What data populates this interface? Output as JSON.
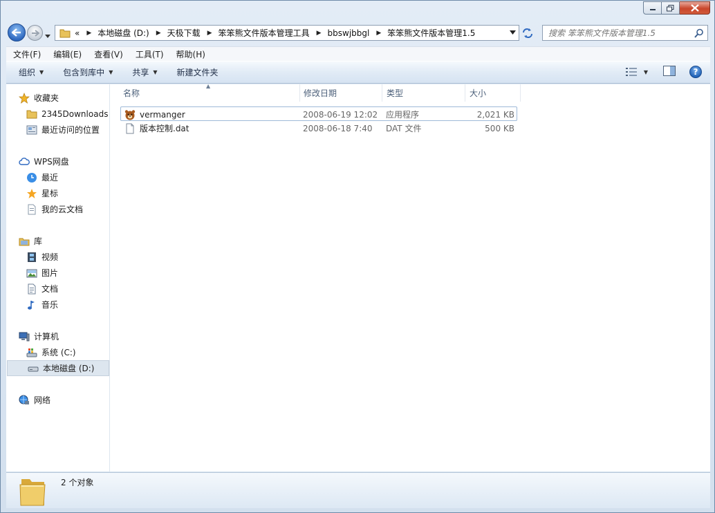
{
  "window": {
    "caption_buttons": [
      "minimize",
      "maximize",
      "close"
    ]
  },
  "address": {
    "overflow": "«",
    "crumbs": [
      "本地磁盘 (D:)",
      "天极下载",
      "笨笨熊文件版本管理工具",
      "bbswjbbgl",
      "笨笨熊文件版本管理1.5"
    ]
  },
  "search": {
    "placeholder": "搜索 笨笨熊文件版本管理1.5"
  },
  "menu": {
    "items": [
      "文件(F)",
      "编辑(E)",
      "查看(V)",
      "工具(T)",
      "帮助(H)"
    ]
  },
  "commands": {
    "organize": "组织",
    "include_in_library": "包含到库中",
    "share": "共享",
    "new_folder": "新建文件夹"
  },
  "nav": {
    "favorites": {
      "label": "收藏夹",
      "items": [
        "2345Downloads",
        "最近访问的位置"
      ]
    },
    "wps": {
      "label": "WPS网盘",
      "items": [
        "最近",
        "星标",
        "我的云文档"
      ]
    },
    "libraries": {
      "label": "库",
      "items": [
        "视频",
        "图片",
        "文档",
        "音乐"
      ]
    },
    "computer": {
      "label": "计算机",
      "items": [
        "系统 (C:)",
        "本地磁盘 (D:)"
      ]
    },
    "network": {
      "label": "网络"
    }
  },
  "columns": [
    "名称",
    "修改日期",
    "类型",
    "大小"
  ],
  "files": [
    {
      "name": "vermanger",
      "modified": "2008-06-19 12:02",
      "type": "应用程序",
      "size": "2,021 KB",
      "icon": "application-bear-icon"
    },
    {
      "name": "版本控制.dat",
      "modified": "2008-06-18 7:40",
      "type": "DAT 文件",
      "size": "500 KB",
      "icon": "generic-file-icon"
    }
  ],
  "details": {
    "summary": "2 个对象"
  },
  "colors": {
    "accent": "#2e69c0",
    "selection_border": "#9db9d8",
    "header_text": "#4c607a"
  }
}
